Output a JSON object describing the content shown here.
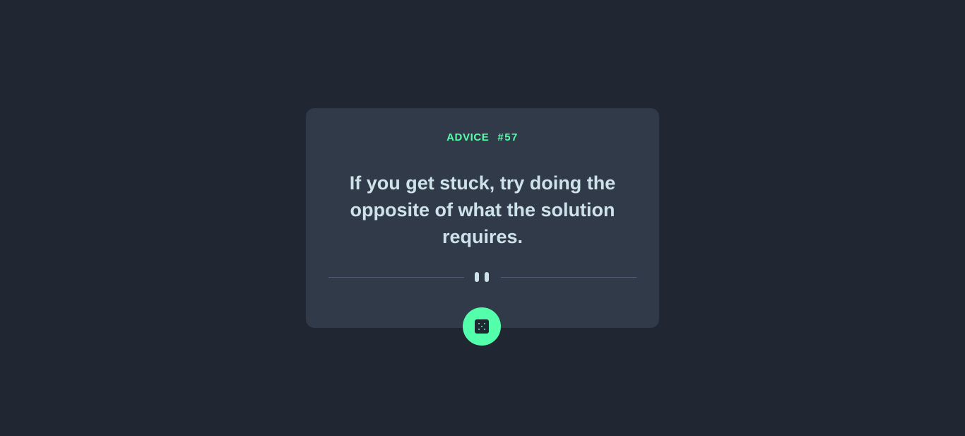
{
  "card": {
    "heading_label": "ADVICE",
    "advice_number": "#57",
    "quote": "If you get stuck, try doing the opposite of what the solution requires."
  },
  "divider": {
    "icon": "pause-icon"
  },
  "dice_button": {
    "icon": "dice-icon"
  },
  "colors": {
    "background": "#202632",
    "card": "#313a49",
    "accent": "#53ffaa",
    "text": "#cee3e9",
    "divider": "#4f5d74"
  }
}
